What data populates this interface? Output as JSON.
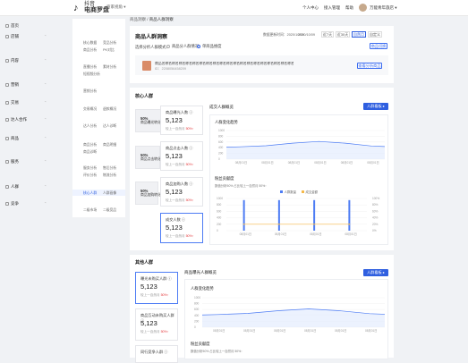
{
  "topbar": {
    "logo_small": "抖音",
    "logo_main": "电商罗盘",
    "switch": "商家视角 ▾",
    "nav": [
      "个人中心",
      "接入管理",
      "帮助"
    ],
    "user": "万能青年旅店 ▾"
  },
  "sidebar": {
    "sections": [
      {
        "label": "首页",
        "y": 26
      },
      {
        "label": "店铺",
        "y": 38,
        "subs": [
          [
            "核心数据",
            "竞品分析"
          ],
          [
            "商品分析",
            "PK对比"
          ]
        ]
      },
      {
        "label": "内容",
        "y": 65,
        "subs": [
          [
            "直播分析",
            "素材分析"
          ],
          [
            "短视频分析"
          ]
        ]
      },
      {
        "label": "营销",
        "y": 92,
        "subs": [
          [
            "营销分析"
          ]
        ]
      },
      {
        "label": "交易",
        "y": 112,
        "subs": [
          [
            "交易概况",
            "退款概况"
          ]
        ]
      },
      {
        "label": "达人合作",
        "y": 131,
        "subs": [
          [
            "达人分析",
            "达人诊断"
          ]
        ]
      },
      {
        "label": "商品",
        "y": 152,
        "subs": [
          [
            "商品分析",
            "商品明细"
          ],
          [
            "商品诊断"
          ]
        ]
      },
      {
        "label": "服务",
        "y": 178,
        "subs": [
          [
            "服务分析",
            "售后分析"
          ],
          [
            "评价分析",
            "物流分析"
          ]
        ]
      },
      {
        "label": "人群",
        "y": 206,
        "subs": [
          [
            "核心人群",
            "人群画像"
          ]
        ]
      },
      {
        "label": "竞争",
        "y": 225,
        "subs": [
          [
            "二级市场",
            "二级竞品"
          ]
        ]
      }
    ]
  },
  "breadcrumb": {
    "parent": "商品洞察",
    "sep": " / ",
    "current": "商品人群洞察"
  },
  "header": {
    "title": "商品人群洞察",
    "update": "数据更新时间：2020/10/09",
    "range": "2020/10/09",
    "segs": [
      "近7天",
      "近30天",
      "自然月",
      "自定义"
    ],
    "active_seg": 2
  },
  "filter": {
    "label": "选择分析人群模式：",
    "opt1": "商品分人群情况",
    "opt2": "单商品维度",
    "button": "商品切换"
  },
  "product": {
    "name": "商品名称名称名称名称名称名称名称名称名称名称名称名称名称名称名称名称名称名称名称名称...",
    "id": "ID：2208056458209",
    "button": "查看分析商品"
  },
  "funnel": {
    "title": "核心人群",
    "conversions": [
      {
        "pct": "50%",
        "label": "商品曝光转化"
      },
      {
        "pct": "50%",
        "label": "商品点击转化"
      },
      {
        "pct": "50%",
        "label": "商品加购转化"
      }
    ],
    "metrics": [
      {
        "name": "商品曝光人数 ⓘ",
        "value": "5,123",
        "cmp_label": "较上一自然月 ",
        "cmp": "50%↑"
      },
      {
        "name": "商品点击人数 ⓘ",
        "value": "5,123",
        "cmp_label": "较上一自然月 ",
        "cmp": "50%↑"
      },
      {
        "name": "商品加购人数 ⓘ",
        "value": "5,123",
        "cmp_label": "较上一自然月 ",
        "cmp": "50%↑"
      },
      {
        "name": "成交人数 ⓘ",
        "value": "5,123",
        "cmp_label": "较上一自然月 ",
        "cmp": "50%↑"
      }
    ]
  },
  "chart1": {
    "panel_title": "成交人群概览",
    "button": "人群看板 ▸",
    "title": "人群变化趋势",
    "yticks": [
      "1000",
      "800",
      "600",
      "400",
      "200",
      "0"
    ],
    "xticks": [
      "08月01日",
      "08月01日",
      "08月01日",
      "08月01日",
      "08月01日",
      "08月01日"
    ]
  },
  "chart2": {
    "title": "粉丝贡献度",
    "note": "数值分析50% 占比较上一自然月 50%↑",
    "legend": [
      "人群数量",
      "成交金额"
    ],
    "yleft": [
      "1000",
      "800",
      "600",
      "400",
      "200",
      "0"
    ],
    "yright": [
      "100%",
      "80%",
      "60%",
      "40%",
      "20%",
      "0%"
    ],
    "xticks": [
      "08月01日",
      "08月01日",
      "08月01日",
      "08月01日"
    ]
  },
  "other": {
    "title": "其他人群",
    "metrics": [
      {
        "name": "曝光未购买人群 ⓘ",
        "value": "5,123",
        "cmp_label": "较上一自然月 ",
        "cmp": "50%↑"
      },
      {
        "name": "商品互动未购买人群 ⓘ",
        "value": "5,123",
        "cmp_label": "较上一自然月 ",
        "cmp": "50%↑"
      },
      {
        "name": "同行竞争人群 ⓘ",
        "value": "5,123",
        "cmp_label": "较上一自然月 ",
        "cmp": "50%↑"
      }
    ],
    "panel_title": "商品曝光人群概览",
    "button": "人群看板 ▸",
    "chart_title": "人群变化趋势",
    "yticks": [
      "1000",
      "800",
      "600",
      "400",
      "200",
      "0"
    ],
    "xticks": [
      "08月01日",
      "08月01日",
      "08月01日",
      "08月01日",
      "08月01日",
      "08月01日"
    ],
    "fans_title": "粉丝贡献度",
    "fans_note": "数值分析50% 占比较上一自然月 50%↑"
  },
  "chart_data": {
    "type": "line",
    "title": "人群变化趋势",
    "categories": [
      "08月01日",
      "08月01日",
      "08月01日",
      "08月01日",
      "08月01日",
      "08月01日"
    ],
    "values": [
      430,
      470,
      560,
      620,
      560,
      460
    ],
    "ylim": [
      0,
      1000
    ],
    "bars": [
      950,
      950,
      950,
      950
    ],
    "bar_line": [
      20,
      20,
      20,
      20
    ]
  },
  "colors": {
    "accent": "#2f5fe0",
    "line": "#4d7cf4",
    "area": "#e4ecfd",
    "bar": "#4d7cf4",
    "line2": "#f5b94a",
    "up": "#e4393c"
  }
}
